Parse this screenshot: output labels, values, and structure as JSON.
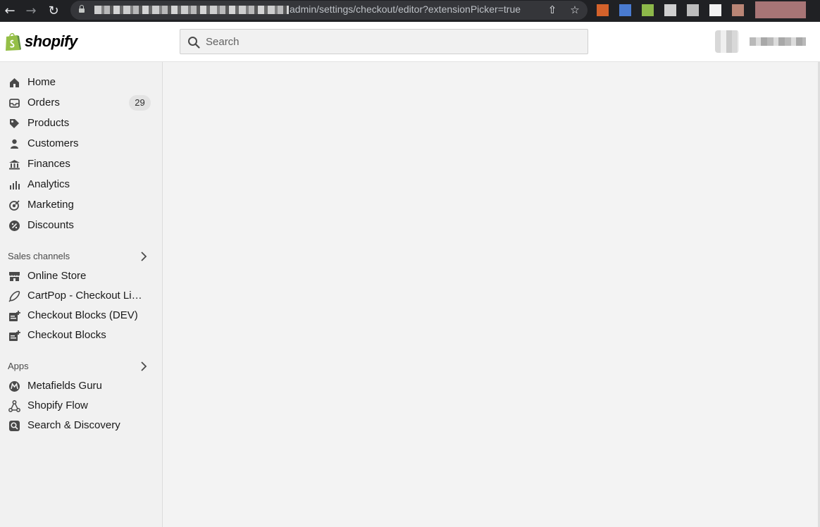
{
  "browser": {
    "url_visible": "admin/settings/checkout/editor?extensionPicker=true",
    "extension_colors": [
      "#d4622b",
      "#4a7bd1",
      "#8db84a",
      "#cfcfcf",
      "#bdbdbd",
      "#f2f2f2",
      "#b98575"
    ]
  },
  "topbar": {
    "logo_text": "shopify",
    "search_placeholder": "Search"
  },
  "sidebar": {
    "items": [
      {
        "label": "Home",
        "icon": "home-icon"
      },
      {
        "label": "Orders",
        "icon": "orders-icon",
        "badge": "29"
      },
      {
        "label": "Products",
        "icon": "tag-icon"
      },
      {
        "label": "Customers",
        "icon": "person-icon"
      },
      {
        "label": "Finances",
        "icon": "bank-icon"
      },
      {
        "label": "Analytics",
        "icon": "bar-chart-icon"
      },
      {
        "label": "Marketing",
        "icon": "target-icon"
      },
      {
        "label": "Discounts",
        "icon": "discount-icon"
      }
    ],
    "sales_channels": {
      "heading": "Sales channels",
      "items": [
        {
          "label": "Online Store",
          "icon": "store-icon"
        },
        {
          "label": "CartPop - Checkout Links",
          "icon": "cartpop-icon"
        },
        {
          "label": "Checkout Blocks (DEV)",
          "icon": "checkout-blocks-icon"
        },
        {
          "label": "Checkout Blocks",
          "icon": "checkout-blocks-icon"
        }
      ]
    },
    "apps": {
      "heading": "Apps",
      "items": [
        {
          "label": "Metafields Guru",
          "icon": "metafields-guru-icon"
        },
        {
          "label": "Shopify Flow",
          "icon": "flow-icon"
        },
        {
          "label": "Search & Discovery",
          "icon": "search-discovery-icon"
        }
      ]
    }
  }
}
